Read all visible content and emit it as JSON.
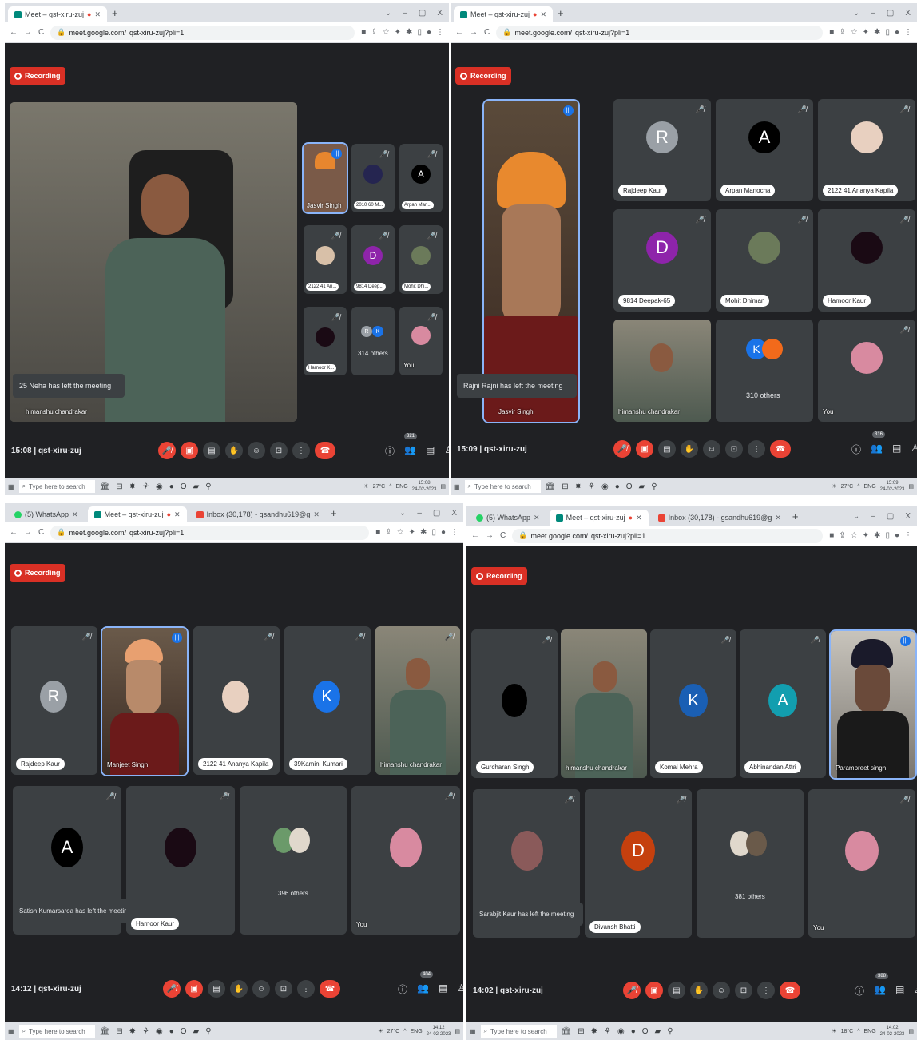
{
  "common": {
    "site_name": "qst-xiru-zuj",
    "url_host": "meet.google.com/",
    "url_path": "qst-xiru-zuj?pli=1",
    "recording_label": "Recording",
    "you_label": "You",
    "search_placeholder": "Type here to search",
    "temp_27": "27°C",
    "temp_18": "18°C",
    "lang": "ENG",
    "new_tab": "+",
    "win_min": "–",
    "win_max": "▢",
    "win_close": "X",
    "win_down": "⌄"
  },
  "q1": {
    "tabs": [
      {
        "label": "Meet – qst-xiru-zuj"
      }
    ],
    "main_speaker": "himanshu chandrakar",
    "toast": "25 Neha has left the meeting",
    "grid": [
      {
        "name": "Jasvir Singh"
      },
      {
        "name": "2010 60 M..."
      },
      {
        "name": "Arpan Man..."
      },
      {
        "name": "2122 41 An..."
      },
      {
        "name": "9814 Deep..."
      },
      {
        "name": "Mohit Dhi..."
      },
      {
        "name": "Harnoor K..."
      },
      {
        "name": "314 others"
      },
      {
        "name": "You"
      }
    ],
    "time": "15:08",
    "participants": "321",
    "clock_time": "15:08",
    "clock_date": "24-02-2023"
  },
  "q2": {
    "tabs": [
      {
        "label": "Meet – qst-xiru-zuj"
      }
    ],
    "main_speaker": "Jasvir Singh",
    "toast": "Rajni Rajni has left the meeting",
    "grid": [
      {
        "name": "Rajdeep Kaur",
        "letter": "R"
      },
      {
        "name": "Arpan Manocha",
        "letter": "A"
      },
      {
        "name": "2122 41 Ananya Kapila"
      },
      {
        "name": "9814 Deepak-65",
        "letter": "D"
      },
      {
        "name": "Mohit Dhiman"
      },
      {
        "name": "Harnoor Kaur"
      },
      {
        "name": "himanshu chandrakar"
      },
      {
        "name": "310 others",
        "letter": "K"
      },
      {
        "name": "You"
      }
    ],
    "time": "15:09",
    "participants": "316",
    "clock_time": "15:09",
    "clock_date": "24-02-2023"
  },
  "q3": {
    "tabs": [
      {
        "label": "(5) WhatsApp"
      },
      {
        "label": "Meet – qst-xiru-zuj"
      },
      {
        "label": "Inbox (30,178) - gsandhu619@g"
      }
    ],
    "grid": [
      {
        "name": "Rajdeep Kaur",
        "letter": "R"
      },
      {
        "name": "Manjeet Singh"
      },
      {
        "name": "2122 41 Ananya Kapila"
      },
      {
        "name": "39Kamini Kumari",
        "letter": "K"
      },
      {
        "name": "himanshu chandrakar"
      },
      {
        "name": "Satish Kumarsaroa has left the meeting",
        "letter": "A"
      },
      {
        "name": "Harnoor Kaur"
      },
      {
        "name": "396 others"
      },
      {
        "name": "You"
      }
    ],
    "time": "14:12",
    "participants": "404",
    "clock_time": "14:12",
    "clock_date": "24-02-2023"
  },
  "q4": {
    "tabs": [
      {
        "label": "(5) WhatsApp"
      },
      {
        "label": "Meet – qst-xiru-zuj"
      },
      {
        "label": "Inbox (30,178) - gsandhu619@g"
      }
    ],
    "grid": [
      {
        "name": "Gurcharan Singh"
      },
      {
        "name": "himanshu chandrakar"
      },
      {
        "name": "Komal Mehra",
        "letter": "K"
      },
      {
        "name": "Abhinandan Attri",
        "letter": "A"
      },
      {
        "name": "Parampreet singh"
      },
      {
        "name": "Sarabjit Kaur has left the meeting"
      },
      {
        "name": "Divansh Bhatti",
        "letter": "D"
      },
      {
        "name": "381 others"
      },
      {
        "name": "You"
      }
    ],
    "time": "14:02",
    "participants": "388",
    "clock_time": "14:02",
    "clock_date": "24-02-2023"
  },
  "colors": {
    "meet_bg": "#202124",
    "tile": "#3c4043",
    "red": "#ea4335",
    "speaker_outline": "#8ab4f8"
  },
  "icons": [
    "mic-off-icon",
    "audio-wave-icon",
    "hand-icon",
    "emoji-icon",
    "present-icon",
    "more-icon",
    "leave-call-icon",
    "info-icon",
    "people-icon",
    "chat-icon",
    "activities-icon",
    "windows-start-icon",
    "search-icon"
  ]
}
